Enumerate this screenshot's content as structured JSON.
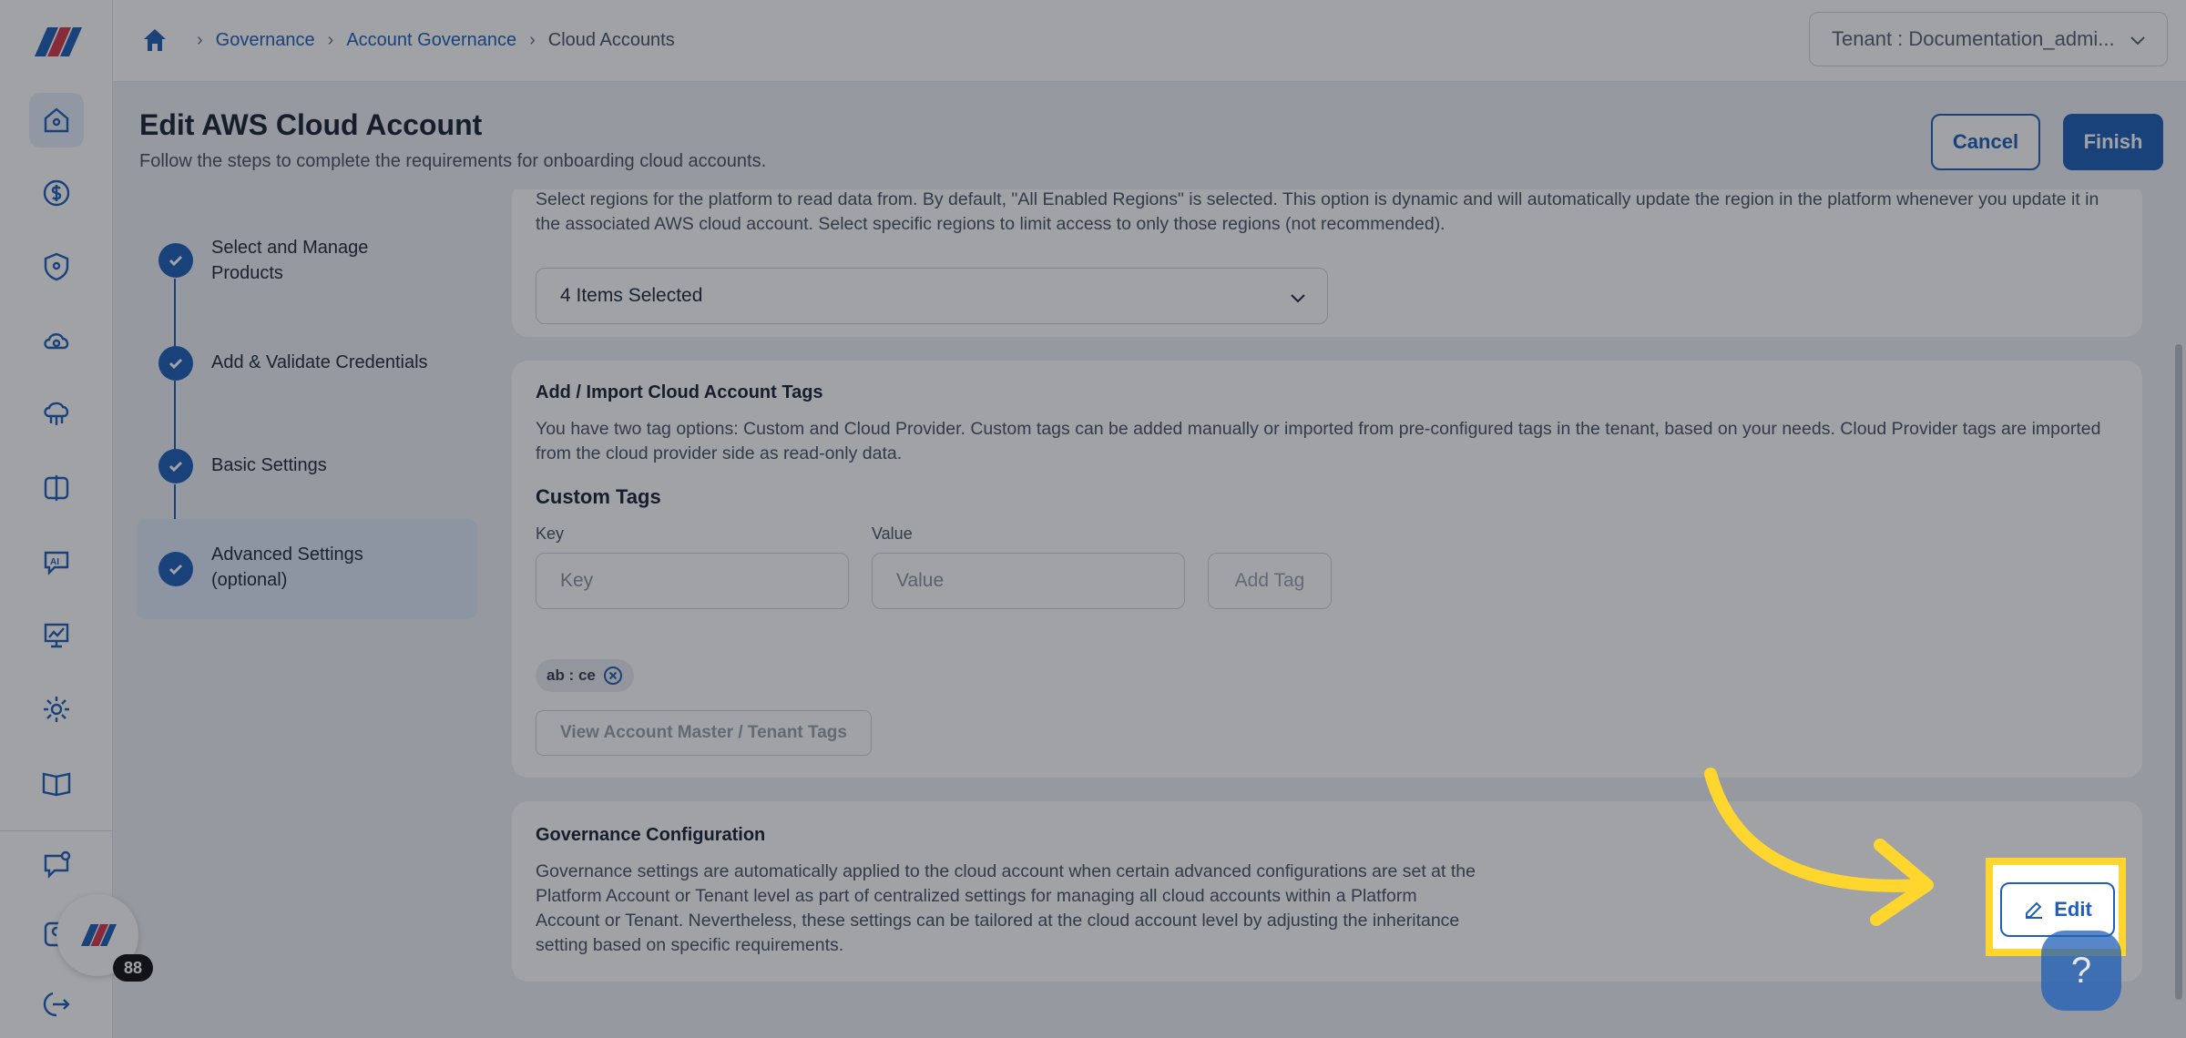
{
  "header": {
    "breadcrumb": [
      "Governance",
      "Account Governance",
      "Cloud Accounts"
    ],
    "tenant_select": "Tenant : Documentation_admi..."
  },
  "page": {
    "title": "Edit AWS Cloud Account",
    "subtitle": "Follow the steps to complete the requirements for onboarding cloud accounts.",
    "cancel_label": "Cancel",
    "finish_label": "Finish"
  },
  "steps": [
    {
      "label": "Select and Manage Products"
    },
    {
      "label": "Add & Validate Credentials"
    },
    {
      "label": "Basic Settings"
    },
    {
      "label": "Advanced Settings (optional)"
    }
  ],
  "regions_card": {
    "description": "Select regions for the platform to read data from. By default, \"All Enabled Regions\" is selected. This option is dynamic and will automatically update the region in the platform whenever you update it in the associated AWS cloud account. Select specific regions to limit access to only those regions (not recommended).",
    "selected": "4 Items Selected"
  },
  "tags_card": {
    "title": "Add / Import Cloud Account Tags",
    "description": "You have two tag options: Custom and Cloud Provider. Custom tags can be added manually or imported from pre-configured tags in the tenant, based on your needs. Cloud Provider tags are imported from the cloud provider side as read-only data.",
    "custom_title": "Custom Tags",
    "key_label": "Key",
    "key_placeholder": "Key",
    "value_label": "Value",
    "value_placeholder": "Value",
    "add_tag_label": "Add Tag",
    "chips": [
      "ab : ce"
    ],
    "view_tags_label": "View Account Master / Tenant Tags"
  },
  "governance_card": {
    "title": "Governance Configuration",
    "description": "Governance settings are automatically applied to the cloud account when certain advanced configurations are set at the Platform Account or Tenant level as part of centralized settings for managing all cloud accounts within a Platform Account or Tenant. Nevertheless, these settings can be tailored at the cloud account level by adjusting the inheritance setting based on specific requirements.",
    "edit_label": "Edit"
  },
  "user": {
    "badge_count": "88"
  },
  "help": {
    "label": "?"
  },
  "colors": {
    "accent": "#1f5fb8",
    "highlight": "#ffd62e"
  }
}
